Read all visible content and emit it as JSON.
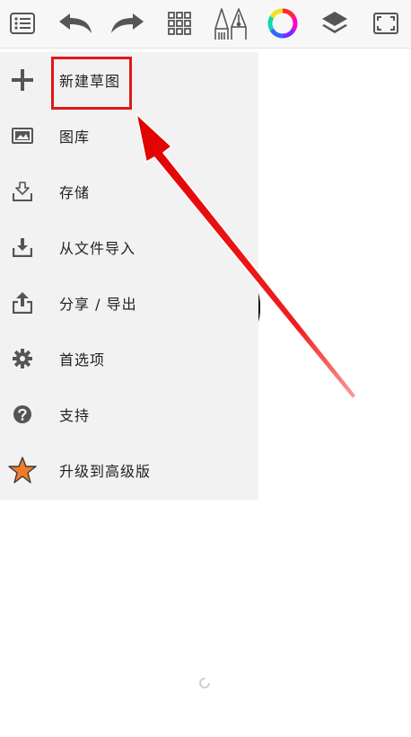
{
  "colors": {
    "toolbar_bg": "#f7f7f7",
    "drawer_bg": "#f2f2f2",
    "icon_gray": "#555555",
    "star_orange": "#f07b2a",
    "annotation_red": "#e01818"
  },
  "toolbar": {
    "items": [
      {
        "name": "list-menu-icon"
      },
      {
        "name": "undo-icon"
      },
      {
        "name": "redo-icon"
      },
      {
        "name": "grid-icon"
      },
      {
        "name": "brush-pen-icon"
      },
      {
        "name": "color-wheel-icon"
      },
      {
        "name": "layers-icon"
      },
      {
        "name": "fullscreen-icon"
      }
    ]
  },
  "menu": {
    "items": [
      {
        "label": "新建草图",
        "icon": "plus-icon"
      },
      {
        "label": "图库",
        "icon": "gallery-icon"
      },
      {
        "label": "存储",
        "icon": "save-icon"
      },
      {
        "label": "从文件导入",
        "icon": "import-icon"
      },
      {
        "label": "分享 / 导出",
        "icon": "share-icon"
      },
      {
        "label": "首选项",
        "icon": "gear-icon"
      },
      {
        "label": "支持",
        "icon": "help-icon"
      },
      {
        "label": "升级到高级版",
        "icon": "star-icon"
      }
    ]
  }
}
